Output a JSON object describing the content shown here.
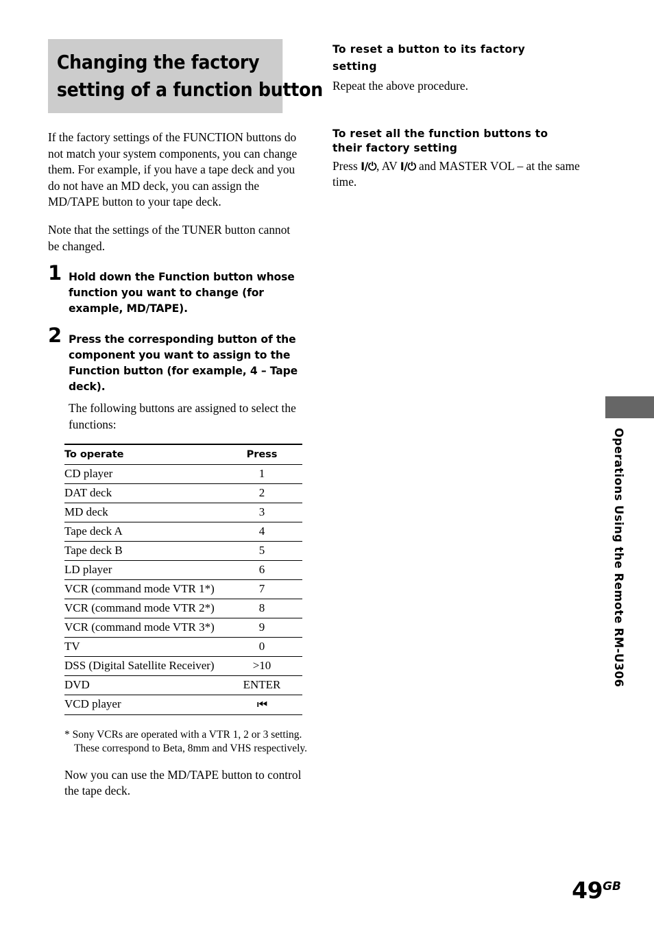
{
  "chapter": {
    "title_line_1": "Changing the factory",
    "title_line_2": "setting of a function button"
  },
  "left_column": {
    "intro_paragraph_1": "If the factory settings of the FUNCTION buttons do not match your system components, you can change them. For example, if you have a tape deck and you do not have an MD deck, you can assign the MD/TAPE button to your tape deck.",
    "intro_paragraph_2": "Note that the settings of the TUNER button cannot be changed.",
    "steps": [
      {
        "number": "1",
        "text": "Hold down the Function button whose function you want to change (for example, MD/TAPE)."
      },
      {
        "number": "2",
        "text": "Press the corresponding button of the component you want to assign to the Function button (for example, 4 – Tape deck).",
        "sub_text": "The following buttons are assigned to select the functions:"
      }
    ],
    "footnote": "* Sony VCRs are operated with a VTR 1, 2 or 3 setting. These correspond to Beta, 8mm and VHS respectively.",
    "closing_paragraph": "Now you can use the MD/TAPE button to control the tape deck."
  },
  "table": {
    "headers": [
      "To operate",
      "Press"
    ],
    "rows": [
      {
        "operate": "CD player",
        "press": "1"
      },
      {
        "operate": "DAT deck",
        "press": "2"
      },
      {
        "operate": "MD deck",
        "press": "3"
      },
      {
        "operate": "Tape deck A",
        "press": "4"
      },
      {
        "operate": "Tape deck B",
        "press": "5"
      },
      {
        "operate": "LD player",
        "press": "6"
      },
      {
        "operate": "VCR (command mode VTR 1*)",
        "press": "7"
      },
      {
        "operate": "VCR (command mode VTR 2*)",
        "press": "8"
      },
      {
        "operate": "VCR (command mode VTR 3*)",
        "press": "9"
      },
      {
        "operate": "TV",
        "press": "0"
      },
      {
        "operate": "DSS (Digital Satellite Receiver)",
        "press": ">10"
      },
      {
        "operate": "DVD",
        "press": "ENTER"
      },
      {
        "operate": "VCD player",
        "press": "⏮"
      }
    ]
  },
  "right_column": {
    "section_1": {
      "heading_line_1": "To reset a button to its factory",
      "heading_line_2": "setting",
      "body": "Repeat the above procedure."
    },
    "section_2": {
      "heading_line_1": "To reset all the function buttons to",
      "heading_line_2": "their factory setting",
      "body_prefix": "Press ",
      "power_symbol_1": "I/⏻",
      "body_middle": ", AV ",
      "power_symbol_2": "I/⏻",
      "body_suffix": " and MASTER VOL – at the same time."
    }
  },
  "side_tab": {
    "label": "Operations Using the Remote RM-U306",
    "block_color": "#666666"
  },
  "footer": {
    "page_number": "49",
    "region_code": "GB"
  },
  "colors": {
    "title_background": "#cccccc",
    "text": "#000000",
    "page_background": "#ffffff"
  }
}
